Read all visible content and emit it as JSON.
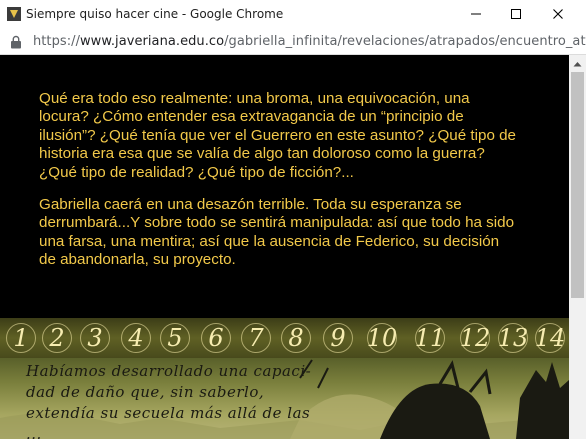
{
  "window": {
    "title": "Siempre quiso hacer cine - Google Chrome",
    "minimize_icon": "minimize-icon",
    "maximize_icon": "maximize-icon",
    "close_icon": "close-icon"
  },
  "addressbar": {
    "scheme": "https://",
    "host": "www.javeriana.edu.co",
    "path": "/gabriella_infinita/revelaciones/atrapados/encuentro_at..."
  },
  "content": {
    "paragraphs": [
      "Qué era todo eso realmente: una broma, una equivocación, una locura? ¿Cómo entender esa extravagancia de un “principio de ilusión”? ¿Qué tenía que ver el Guerrero en este asunto? ¿Qué tipo de historia era esa que se valía de algo tan doloroso como la guerra? ¿Qué tipo de realidad? ¿Qué tipo de ficción?...",
      "Gabriella caerá en una desazón terrible. Toda su esperanza se derrumbará...Y sobre todo se sentirá manipulada: así que todo ha sido una farsa, una mentira; así que la ausencia de Federico, su decisión de abandonarla, su proyecto."
    ],
    "nav_numbers": [
      "1",
      "2",
      "3",
      "4",
      "5",
      "6",
      "7",
      "8",
      "9",
      "10",
      "11",
      "12",
      "13",
      "14"
    ],
    "handwriting": [
      "Habíamos desarrollado una capaci-",
      "dad de daño que, sin saberlo,",
      "extendía su secuela más allá de las",
      "..."
    ]
  },
  "colors": {
    "text": "#f2c94a",
    "background": "#000000"
  }
}
